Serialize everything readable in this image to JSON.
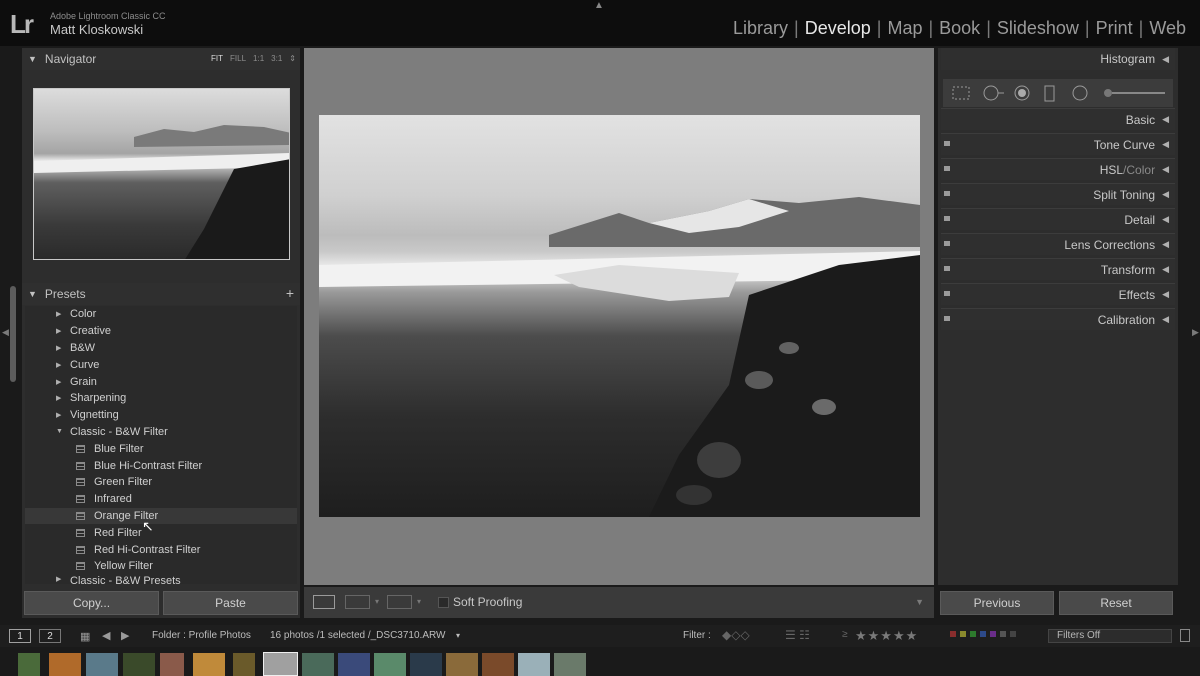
{
  "app": {
    "product": "Adobe Lightroom Classic CC",
    "user": "Matt Kloskowski",
    "logo": "Lr"
  },
  "modules": [
    "Library",
    "Develop",
    "Map",
    "Book",
    "Slideshow",
    "Print",
    "Web"
  ],
  "active_module": "Develop",
  "navigator": {
    "title": "Navigator",
    "zoom_options": [
      "FIT",
      "FILL",
      "1:1",
      "3:1"
    ],
    "selected_zoom": "FIT"
  },
  "presets": {
    "title": "Presets",
    "add_icon": "+",
    "folders": [
      "Color",
      "Creative",
      "B&W",
      "Curve",
      "Grain",
      "Sharpening",
      "Vignetting"
    ],
    "open_folder": "Classic - B&W Filter",
    "items": [
      "Blue Filter",
      "Blue Hi-Contrast Filter",
      "Green Filter",
      "Infrared",
      "Orange Filter",
      "Red Filter",
      "Red Hi-Contrast Filter",
      "Yellow Filter"
    ],
    "hovered_item": "Orange Filter",
    "next_folder": "Classic - B&W Presets"
  },
  "left_buttons": {
    "copy": "Copy...",
    "paste": "Paste"
  },
  "toolbar": {
    "soft_proofing": "Soft Proofing"
  },
  "right_panel": {
    "histogram": "Histogram",
    "sections": [
      "Basic",
      "Tone Curve",
      "HSL",
      "Color",
      "Split Toning",
      "Detail",
      "Lens Corrections",
      "Transform",
      "Effects",
      "Calibration"
    ],
    "hsl_separator": "/"
  },
  "right_buttons": {
    "previous": "Previous",
    "reset": "Reset"
  },
  "filmstrip_bar": {
    "pages": [
      "1",
      "2"
    ],
    "source": "Folder : Profile Photos",
    "count": "16 photos /1 selected /_DSC3710.ARW",
    "filter_label": "Filter :",
    "filters_off": "Filters Off"
  }
}
